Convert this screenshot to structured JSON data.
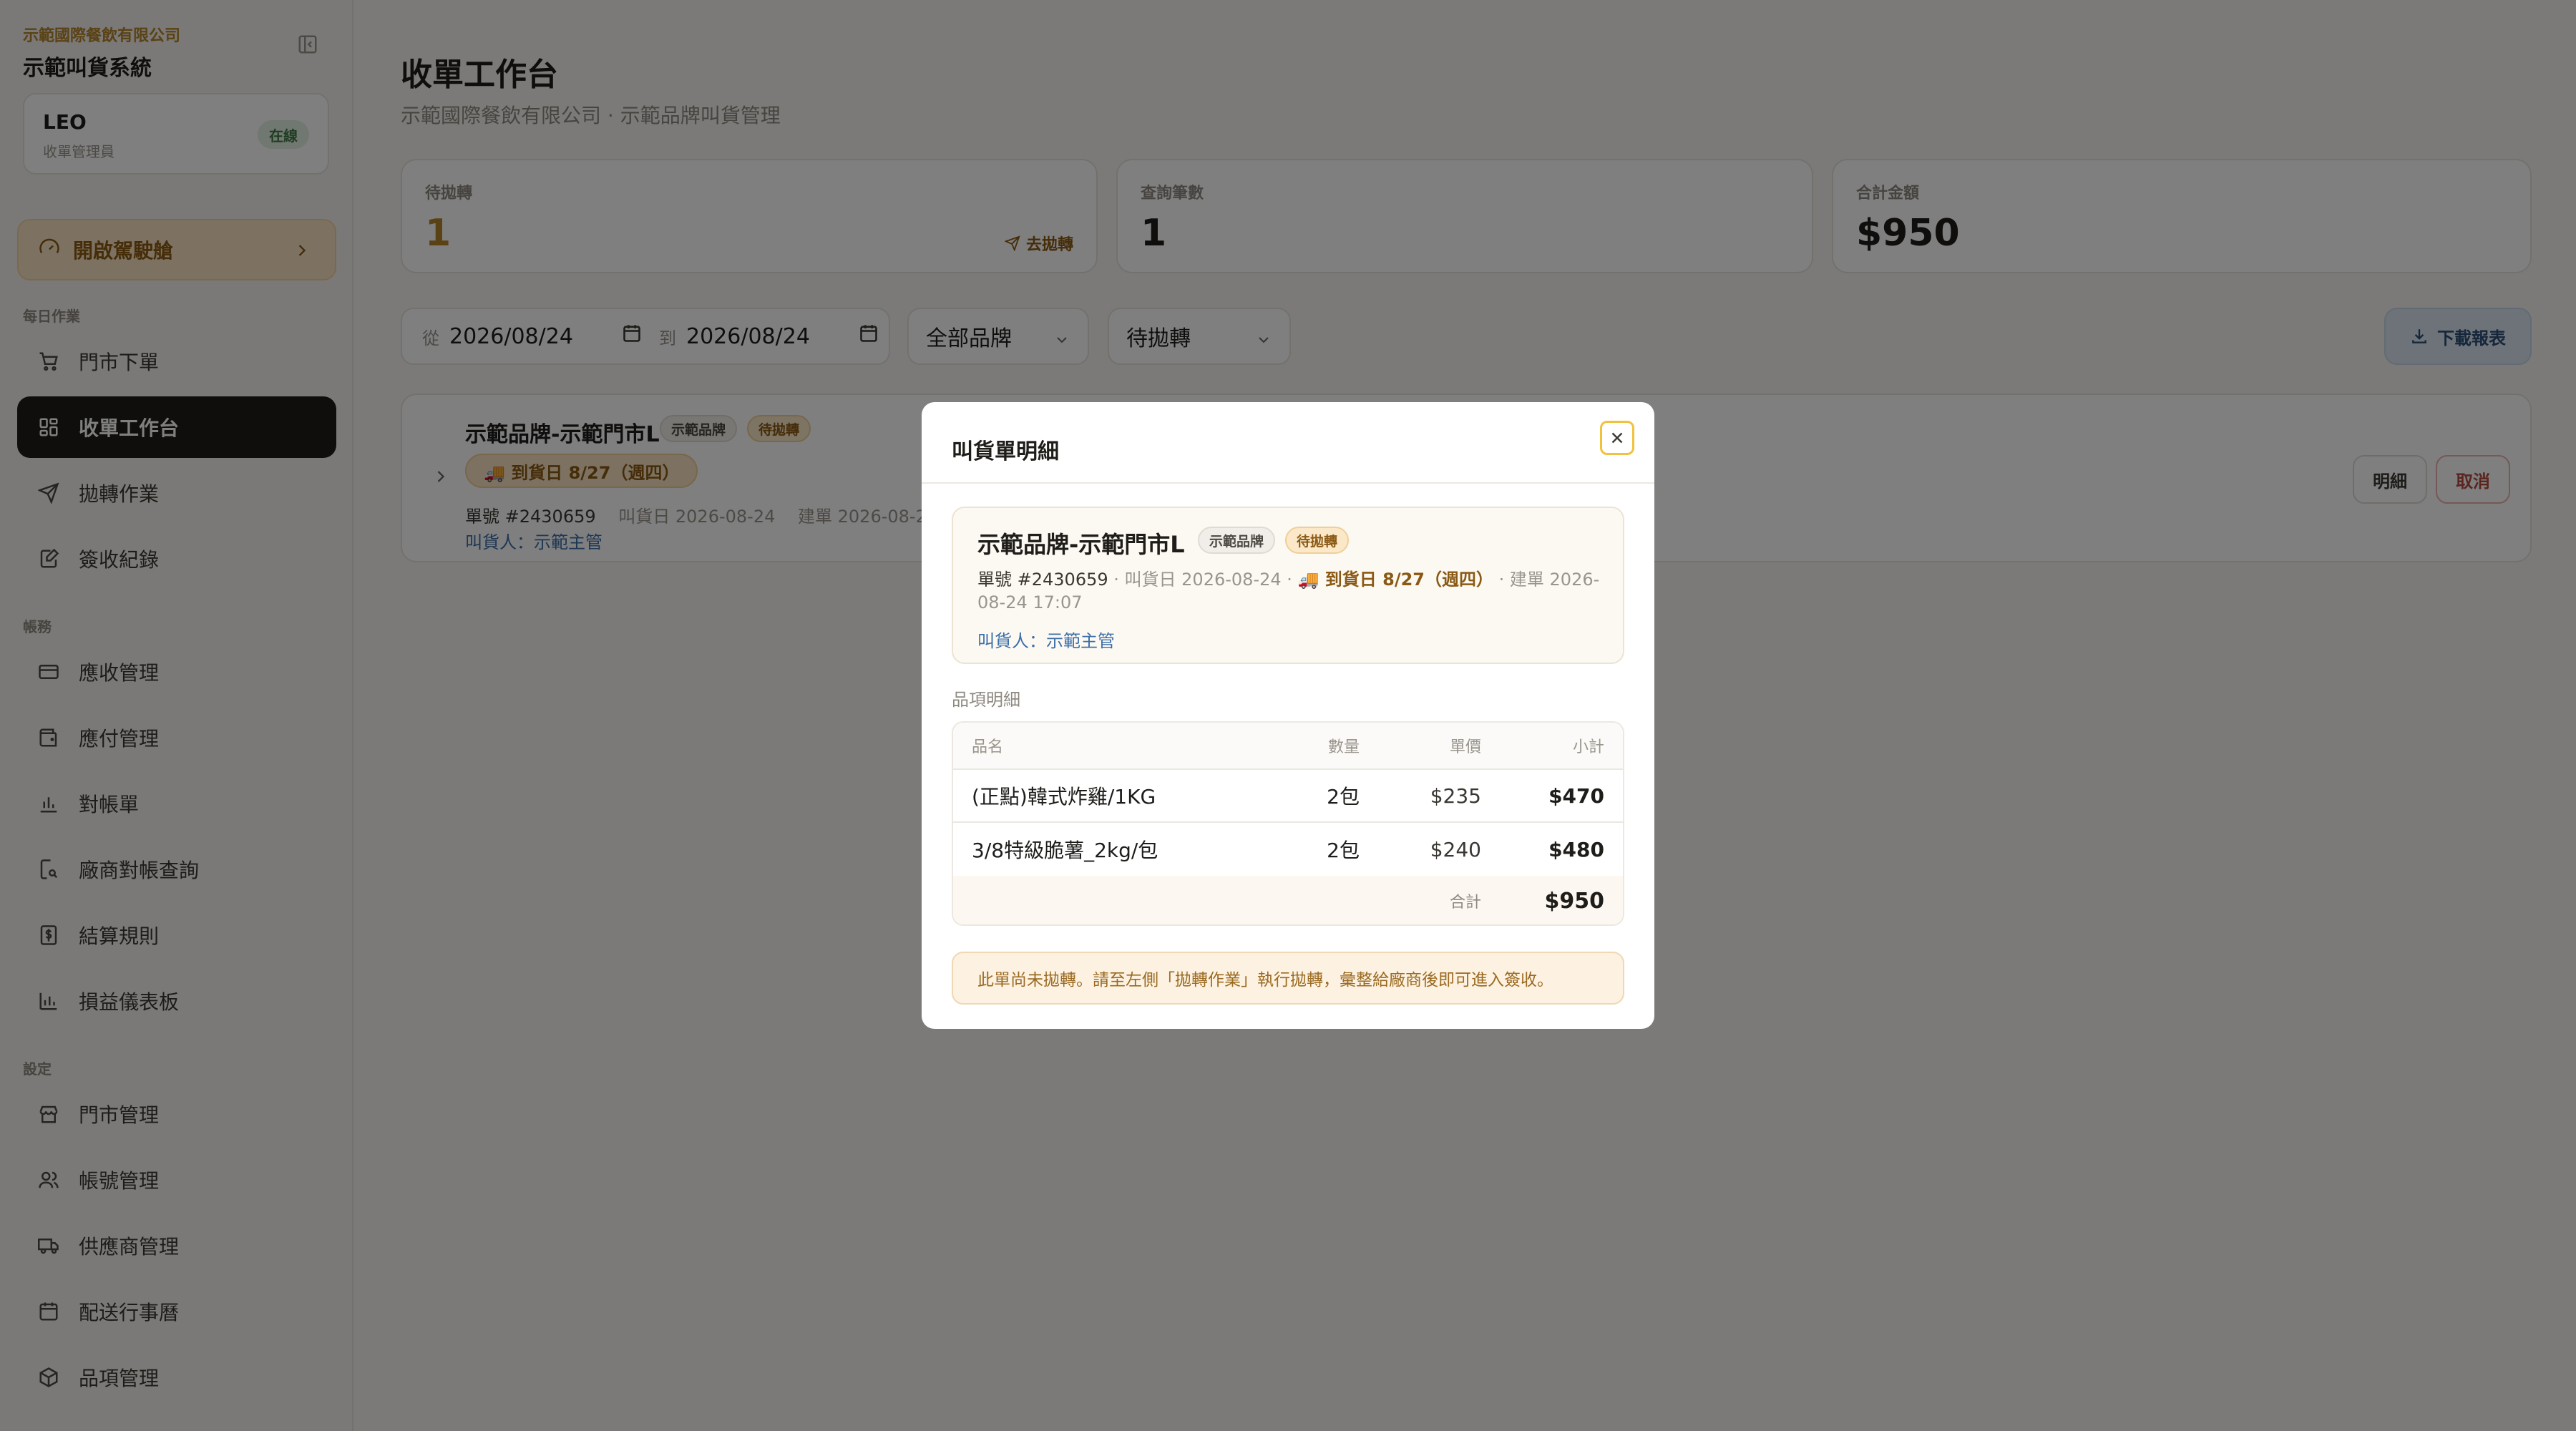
{
  "sidebar": {
    "company": "示範國際餐飲有限公司",
    "system_name": "示範叫貨系統",
    "user": {
      "name": "LEO",
      "role": "收單管理員",
      "status": "在線"
    },
    "drive_button": "開啟駕駛艙",
    "sections": {
      "daily": "每日作業",
      "accounts": "帳務",
      "settings": "設定"
    },
    "items": {
      "store_order": "門市下單",
      "workbench": "收單工作台",
      "transfer": "拋轉作業",
      "receipt": "簽收紀錄",
      "receivable": "應收管理",
      "payable": "應付管理",
      "statement": "對帳單",
      "vendor_query": "廠商對帳查詢",
      "settlement": "結算規則",
      "pnl": "損益儀表板",
      "store_mgmt": "門市管理",
      "account_mgmt": "帳號管理",
      "supplier_mgmt": "供應商管理",
      "delivery_calendar": "配送行事曆",
      "item_mgmt": "品項管理"
    }
  },
  "header": {
    "title": "收單工作台",
    "subtitle": "示範國際餐飲有限公司 · 示範品牌叫貨管理"
  },
  "stats": {
    "pending_label": "待拋轉",
    "pending_value": "1",
    "pending_link": "去拋轉",
    "count_label": "查詢筆數",
    "count_value": "1",
    "total_label": "合計金額",
    "total_value": "$950"
  },
  "filters": {
    "from_label": "從",
    "from_date": "2026/08/24",
    "to_label": "到",
    "to_date": "2026/08/24",
    "brand": "全部品牌",
    "status": "待拋轉",
    "download": "下載報表"
  },
  "order_row": {
    "title": "示範品牌-示範門市L",
    "brand_tag": "示範品牌",
    "status_tag": "待拋轉",
    "arrival": "🚚 到貨日 8/27（週四）",
    "order_no": "單號 #2430659",
    "order_date": "叫貨日 2026-08-24",
    "created": "建單 2026-08-2",
    "orderer": "叫貨人：示範主管",
    "detail_btn": "明細",
    "cancel_btn": "取消"
  },
  "modal": {
    "title": "叫貨單明細",
    "store": "示範品牌-示範門市L",
    "brand_tag": "示範品牌",
    "status_tag": "待拋轉",
    "order_no": "單號 #2430659",
    "order_date": "· 叫貨日 2026-08-24 ·",
    "arrival": "🚚 到貨日 8/27（週四）",
    "created": "· 建單 2026-08-24 17:07",
    "orderer": "叫貨人：示範主管",
    "items_label": "品項明細",
    "columns": {
      "name": "品名",
      "qty": "數量",
      "price": "單價",
      "subtotal": "小計"
    },
    "rows": [
      {
        "name": "(正點)韓式炸雞/1KG",
        "qty": "2包",
        "price": "$235",
        "subtotal": "$470"
      },
      {
        "name": "3/8特級脆薯_2kg/包",
        "qty": "2包",
        "price": "$240",
        "subtotal": "$480"
      }
    ],
    "total_label": "合計",
    "total": "$950",
    "notice": "此單尚未拋轉。請至左側「拋轉作業」執行拋轉，彙整給廠商後即可進入簽收。"
  }
}
